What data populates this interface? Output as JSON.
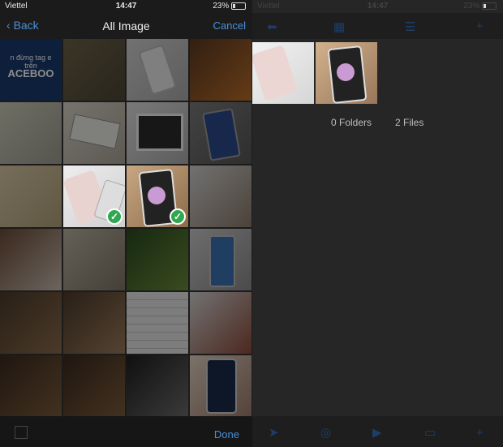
{
  "left": {
    "status": {
      "carrier": "Viettel",
      "time": "14:47",
      "battery": "23%"
    },
    "nav": {
      "back": "Back",
      "title": "All Image",
      "cancel": "Cancel"
    },
    "tile_text": {
      "line1": "n đừng tag e",
      "line2": "trên",
      "line3": "ACEBOO"
    },
    "bottom": {
      "done": "Done"
    }
  },
  "right": {
    "status": {
      "carrier": "Viettel",
      "time": "14:47",
      "battery": "23%"
    },
    "folders": "0 Folders",
    "files": "2 Files"
  }
}
